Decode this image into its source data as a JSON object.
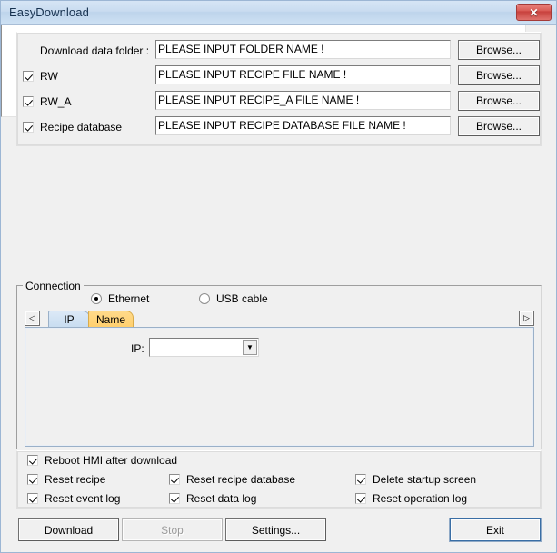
{
  "window": {
    "title": "EasyDownload",
    "close_label": "✕"
  },
  "files": {
    "folder_label": "Download data folder :",
    "rows": [
      {
        "name": "folder",
        "checkbox": null,
        "checked": null,
        "value": "PLEASE INPUT FOLDER NAME !",
        "browse": "Browse..."
      },
      {
        "name": "rw",
        "checkbox": "RW",
        "checked": true,
        "value": "PLEASE INPUT RECIPE FILE NAME !",
        "browse": "Browse..."
      },
      {
        "name": "rw_a",
        "checkbox": "RW_A",
        "checked": true,
        "value": "PLEASE INPUT RECIPE_A FILE NAME !",
        "browse": "Browse..."
      },
      {
        "name": "recipedb",
        "checkbox": "Recipe database",
        "checked": true,
        "value": "PLEASE INPUT RECIPE DATABASE FILE NAME !",
        "browse": "Browse..."
      }
    ]
  },
  "log": {
    "content": ""
  },
  "connection": {
    "group_title": "Connection",
    "radios": [
      {
        "label": "Ethernet",
        "selected": true
      },
      {
        "label": "USB cable",
        "selected": false
      }
    ],
    "tabs": [
      {
        "label": "IP",
        "selected": true
      },
      {
        "label": "Name",
        "selected": false
      }
    ],
    "scroll_left": "◁",
    "scroll_right": "▷",
    "ip_label": "IP:",
    "ip_value": "",
    "ip_arrow": "▼"
  },
  "options": [
    {
      "label": "Reboot HMI after download",
      "checked": true
    },
    {
      "label": "Reset recipe",
      "checked": true
    },
    {
      "label": "Reset recipe database",
      "checked": true
    },
    {
      "label": "Delete startup screen",
      "checked": true
    },
    {
      "label": "Reset event log",
      "checked": true
    },
    {
      "label": "Reset data log",
      "checked": true
    },
    {
      "label": "Reset operation log",
      "checked": true
    }
  ],
  "footer": {
    "download": "Download",
    "stop": "Stop",
    "settings": "Settings...",
    "exit": "Exit"
  },
  "colors": {
    "titlebar": "#c9dcf0",
    "close": "#d95a54",
    "tab_selected": "#c7dcf0",
    "tab_alt": "#ffcf6d",
    "window_bg": "#f0f0f0"
  }
}
